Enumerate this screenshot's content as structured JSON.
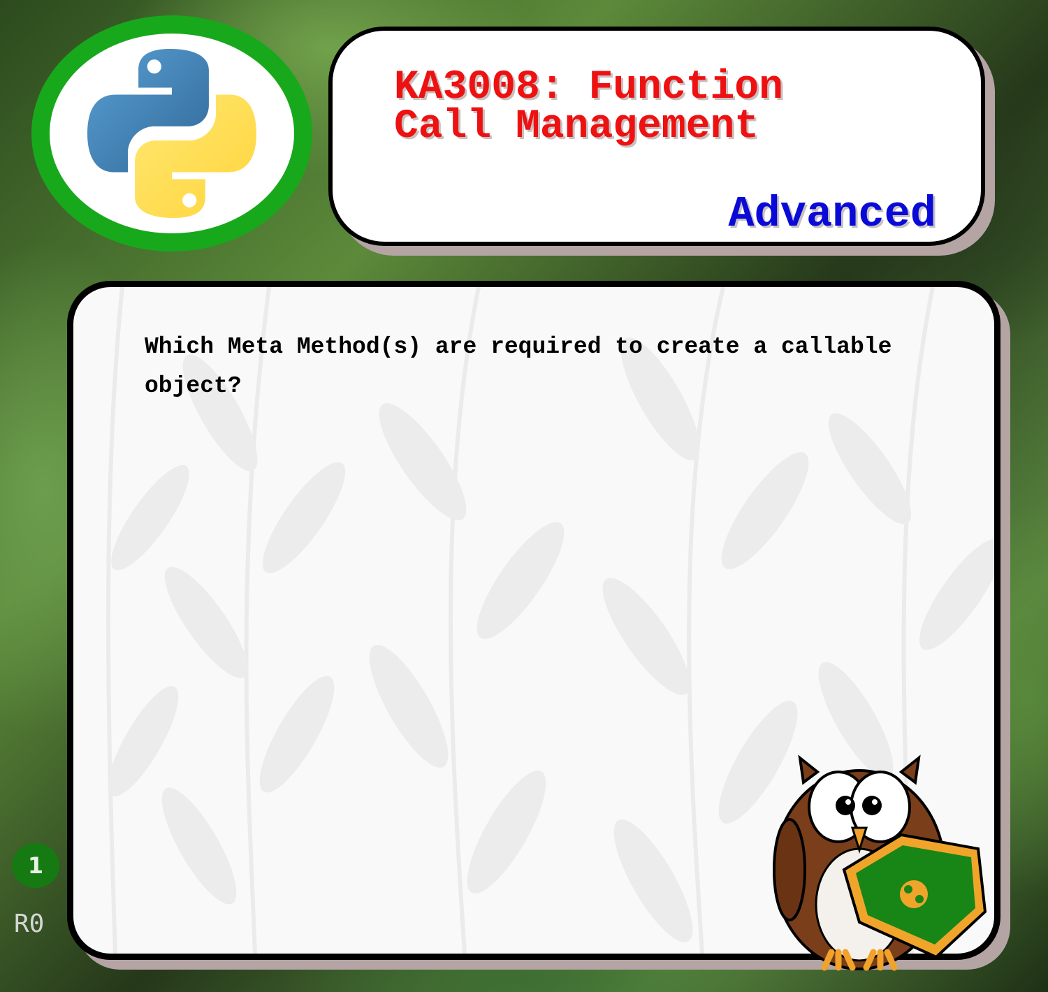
{
  "header": {
    "title": "KA3008: Function\nCall Management",
    "level": "Advanced"
  },
  "card": {
    "question": "Which Meta Method(s) are required to create a callable object?"
  },
  "footer": {
    "page_number": "1",
    "revision": "R0"
  },
  "icons": {
    "logo": "python-logo-icon",
    "mascot": "owl-mascot-icon",
    "shield": "python-shield-icon"
  },
  "colors": {
    "title": "#ee1111",
    "level": "#0a0ad8",
    "logo_ring": "#18a81c",
    "badge": "#157a12"
  }
}
